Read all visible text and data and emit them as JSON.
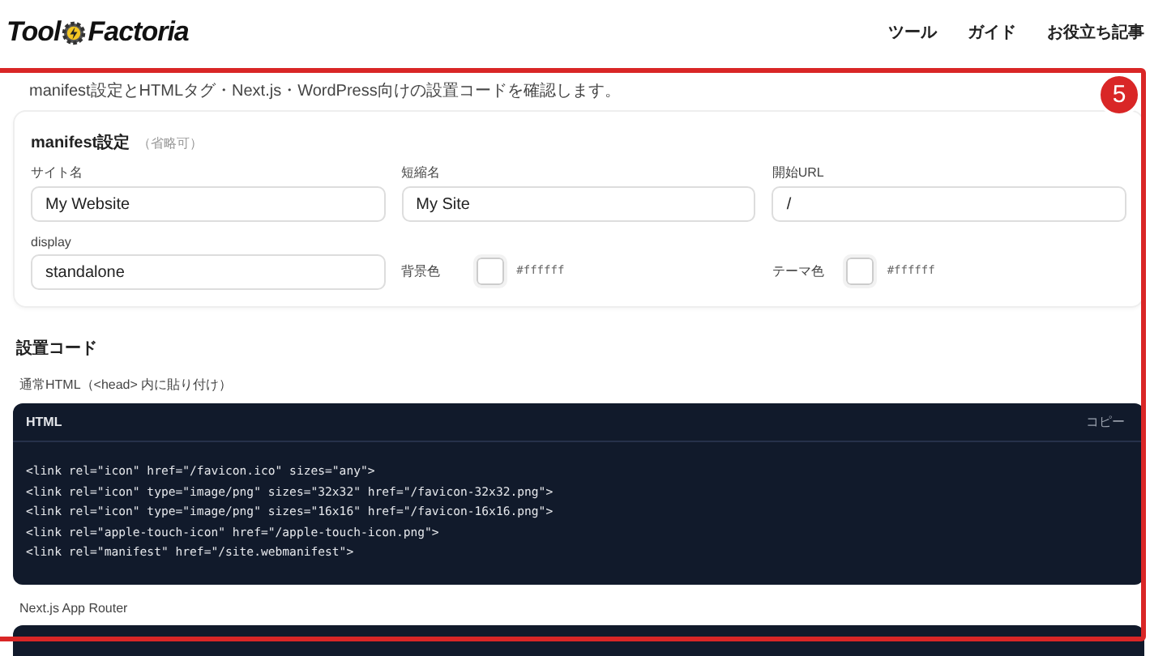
{
  "header": {
    "logo": {
      "left": "Tool",
      "right": "Factoria"
    },
    "nav": [
      {
        "label": "ツール"
      },
      {
        "label": "ガイド"
      },
      {
        "label": "お役立ち記事"
      }
    ]
  },
  "annotation": {
    "number": "5"
  },
  "description": "manifest設定とHTMLタグ・Next.js・WordPress向けの設置コードを確認します。",
  "manifest": {
    "title": "manifest設定",
    "note": "（省略可）",
    "fields": [
      {
        "kind": "text",
        "label": "サイト名",
        "value": "My Website"
      },
      {
        "kind": "text",
        "label": "短縮名",
        "value": "My Site"
      },
      {
        "kind": "text",
        "label": "開始URL",
        "value": "/"
      },
      {
        "kind": "text",
        "label": "display",
        "value": "standalone"
      },
      {
        "kind": "color",
        "label": "背景色",
        "value": "#ffffff"
      },
      {
        "kind": "color",
        "label": "テーマ色",
        "value": "#ffffff"
      }
    ]
  },
  "install": {
    "title": "設置コード",
    "sections": [
      {
        "label": "通常HTML（<head> 内に貼り付け）",
        "code": {
          "language": "HTML",
          "copy": "コピー",
          "lines": [
            "<link rel=\"icon\" href=\"/favicon.ico\" sizes=\"any\">",
            "<link rel=\"icon\" type=\"image/png\" sizes=\"32x32\" href=\"/favicon-32x32.png\">",
            "<link rel=\"icon\" type=\"image/png\" sizes=\"16x16\" href=\"/favicon-16x16.png\">",
            "<link rel=\"apple-touch-icon\" href=\"/apple-touch-icon.png\">",
            "<link rel=\"manifest\" href=\"/site.webmanifest\">"
          ]
        }
      },
      {
        "label": "Next.js App Router"
      }
    ]
  }
}
